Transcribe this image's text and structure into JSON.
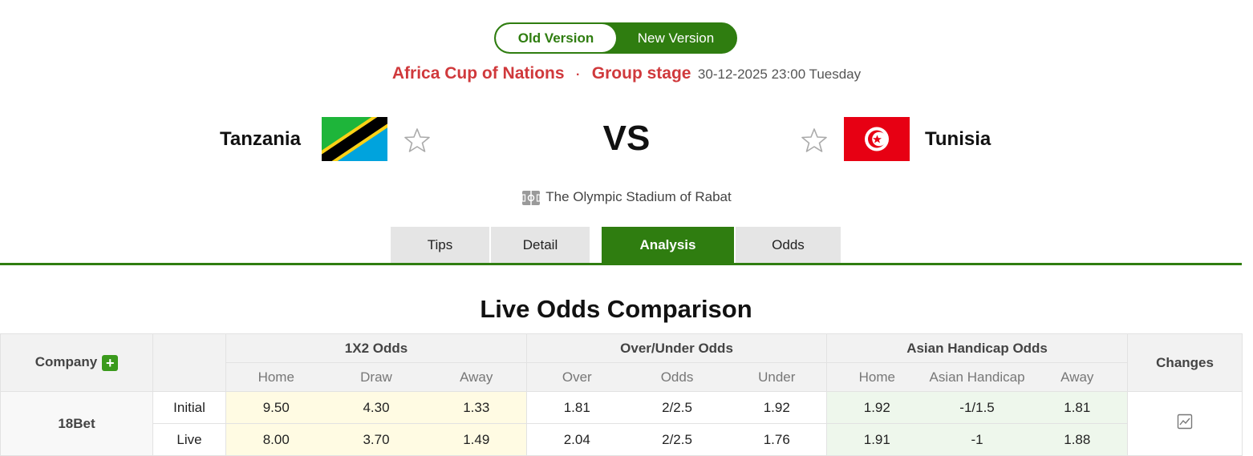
{
  "version_toggle": {
    "old": "Old Version",
    "new": "New Version"
  },
  "match": {
    "competition": "Africa Cup of Nations",
    "separator": "·",
    "stage": "Group stage",
    "datetime": "30-12-2025 23:00 Tuesday",
    "home_team": "Tanzania",
    "away_team": "Tunisia",
    "vs": "VS",
    "venue": "The Olympic Stadium of Rabat"
  },
  "tabs": [
    "Tips",
    "Detail",
    "Analysis",
    "Odds"
  ],
  "active_tab": "Analysis",
  "section_title": "Live Odds Comparison",
  "table": {
    "company_header": "Company",
    "groups": [
      "1X2 Odds",
      "Over/Under Odds",
      "Asian Handicap Odds"
    ],
    "changes_header": "Changes",
    "subheaders": [
      "Home",
      "Draw",
      "Away",
      "Over",
      "Odds",
      "Under",
      "Home",
      "Asian Handicap",
      "Away"
    ],
    "bookmaker": "18Bet",
    "rows": [
      {
        "label": "Initial",
        "values": [
          "9.50",
          "4.30",
          "1.33",
          "1.81",
          "2/2.5",
          "1.92",
          "1.92",
          "-1/1.5",
          "1.81"
        ]
      },
      {
        "label": "Live",
        "values": [
          "8.00",
          "3.70",
          "1.49",
          "2.04",
          "2/2.5",
          "1.76",
          "1.91",
          "-1",
          "1.88"
        ]
      }
    ]
  },
  "colors": {
    "accent_green": "#2f7d10",
    "competition_red": "#d0393c"
  },
  "icons": {
    "favorite": "star-outline-icon",
    "venue": "stadium-icon",
    "add": "plus-icon",
    "changes": "line-chart-icon"
  }
}
